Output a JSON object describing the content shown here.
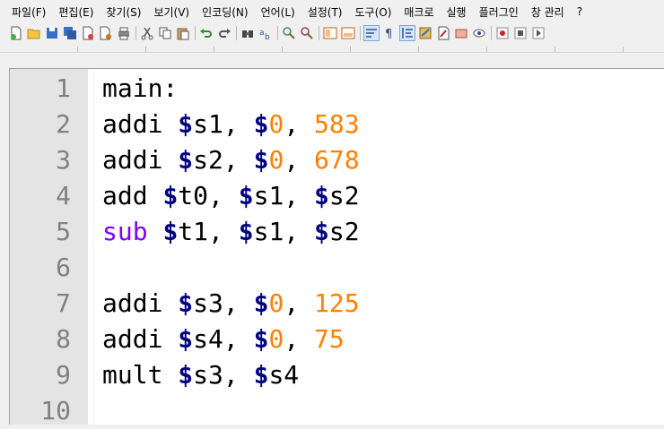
{
  "menu": [
    "파일(F)",
    "편집(E)",
    "찾기(S)",
    "보기(V)",
    "인코딩(N)",
    "언어(L)",
    "설정(T)",
    "도구(O)",
    "매크로",
    "실행",
    "플러그인",
    "창 관리",
    "?"
  ],
  "toolbar_icons": [
    "new-file-icon",
    "open-file-icon",
    "save-icon",
    "save-all-icon",
    "close-icon",
    "close-all-icon",
    "print-icon",
    "cut-icon",
    "copy-icon",
    "paste-icon",
    "undo-icon",
    "redo-icon",
    "find-icon",
    "replace-icon",
    "zoom-in-icon",
    "zoom-out-icon",
    "sync-vertical-icon",
    "sync-horizontal-icon",
    "word-wrap-icon",
    "show-all-chars-icon",
    "indent-guide-icon",
    "user-define-lang-icon",
    "doc-map-icon",
    "function-list-icon",
    "folder-workspace-icon",
    "monitoring-icon",
    "record-macro-icon",
    "stop-record-icon",
    "play-macro-icon"
  ],
  "colors": {
    "dollar": "#000080",
    "number": "#ff8000",
    "keyword": "#8000ff",
    "gutter": "#e4e4e4",
    "line_number": "#808080"
  },
  "line_numbers": [
    "1",
    "2",
    "3",
    "4",
    "5",
    "6",
    "7",
    "8",
    "9",
    "10"
  ],
  "lines": [
    {
      "tokens": [
        {
          "t": "main:",
          "c": "plain"
        }
      ]
    },
    {
      "tokens": [
        {
          "t": "addi ",
          "c": "plain"
        },
        {
          "t": "$",
          "c": "dollar"
        },
        {
          "t": "s1, ",
          "c": "plain"
        },
        {
          "t": "$",
          "c": "dollar"
        },
        {
          "t": "0",
          "c": "num"
        },
        {
          "t": ", ",
          "c": "plain"
        },
        {
          "t": "583",
          "c": "num"
        }
      ]
    },
    {
      "tokens": [
        {
          "t": "addi ",
          "c": "plain"
        },
        {
          "t": "$",
          "c": "dollar"
        },
        {
          "t": "s2, ",
          "c": "plain"
        },
        {
          "t": "$",
          "c": "dollar"
        },
        {
          "t": "0",
          "c": "num"
        },
        {
          "t": ", ",
          "c": "plain"
        },
        {
          "t": "678",
          "c": "num"
        }
      ]
    },
    {
      "tokens": [
        {
          "t": "add ",
          "c": "plain"
        },
        {
          "t": "$",
          "c": "dollar"
        },
        {
          "t": "t0, ",
          "c": "plain"
        },
        {
          "t": "$",
          "c": "dollar"
        },
        {
          "t": "s1, ",
          "c": "plain"
        },
        {
          "t": "$",
          "c": "dollar"
        },
        {
          "t": "s2",
          "c": "plain"
        }
      ]
    },
    {
      "tokens": [
        {
          "t": "sub",
          "c": "kw"
        },
        {
          "t": " ",
          "c": "plain"
        },
        {
          "t": "$",
          "c": "dollar"
        },
        {
          "t": "t1, ",
          "c": "plain"
        },
        {
          "t": "$",
          "c": "dollar"
        },
        {
          "t": "s1, ",
          "c": "plain"
        },
        {
          "t": "$",
          "c": "dollar"
        },
        {
          "t": "s2",
          "c": "plain"
        }
      ]
    },
    {
      "tokens": []
    },
    {
      "tokens": [
        {
          "t": "addi ",
          "c": "plain"
        },
        {
          "t": "$",
          "c": "dollar"
        },
        {
          "t": "s3, ",
          "c": "plain"
        },
        {
          "t": "$",
          "c": "dollar"
        },
        {
          "t": "0",
          "c": "num"
        },
        {
          "t": ", ",
          "c": "plain"
        },
        {
          "t": "125",
          "c": "num"
        }
      ]
    },
    {
      "tokens": [
        {
          "t": "addi ",
          "c": "plain"
        },
        {
          "t": "$",
          "c": "dollar"
        },
        {
          "t": "s4, ",
          "c": "plain"
        },
        {
          "t": "$",
          "c": "dollar"
        },
        {
          "t": "0",
          "c": "num"
        },
        {
          "t": ", ",
          "c": "plain"
        },
        {
          "t": "75",
          "c": "num"
        }
      ]
    },
    {
      "tokens": [
        {
          "t": "mult ",
          "c": "plain"
        },
        {
          "t": "$",
          "c": "dollar"
        },
        {
          "t": "s3, ",
          "c": "plain"
        },
        {
          "t": "$",
          "c": "dollar"
        },
        {
          "t": "s4",
          "c": "plain"
        }
      ]
    },
    {
      "tokens": []
    }
  ]
}
